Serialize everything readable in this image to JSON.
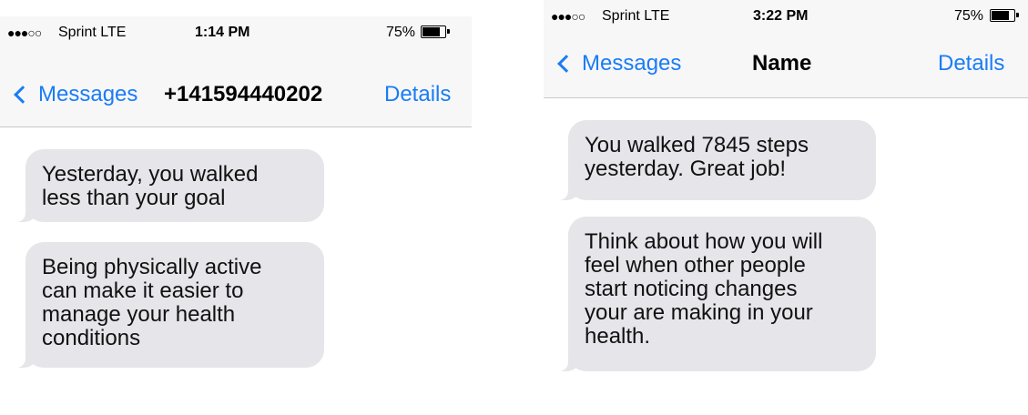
{
  "colors": {
    "accent": "#1a7cf5",
    "bubble": "#e5e5ea",
    "header": "#f7f7f8"
  },
  "left": {
    "status": {
      "signal": "●●●○○",
      "carrier": "Sprint  LTE",
      "time": "1:14 PM",
      "battery": "75%"
    },
    "nav": {
      "back_label": "Messages",
      "title": "+141594440202",
      "details_label": "Details"
    },
    "messages": [
      {
        "text": "Yesterday, you walked\nless than your goal"
      },
      {
        "text": "Being physically active\ncan make it easier to\nmanage your health\nconditions"
      }
    ]
  },
  "right": {
    "status": {
      "signal": "●●●○○",
      "carrier": "Sprint  LTE",
      "time": "3:22 PM",
      "battery": "75%"
    },
    "nav": {
      "back_label": "Messages",
      "title": "Name",
      "details_label": "Details"
    },
    "messages": [
      {
        "text": "You walked 7845 steps\nyesterday. Great job!"
      },
      {
        "text": "Think about how you will\nfeel when other people\nstart noticing changes\nyour are making in your\nhealth."
      }
    ]
  }
}
